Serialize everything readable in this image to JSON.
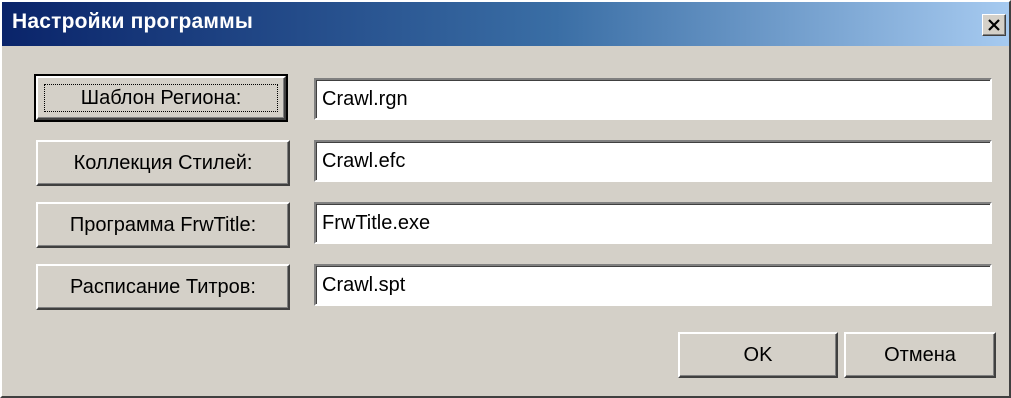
{
  "window": {
    "title": "Настройки программы",
    "close_symbol": "×"
  },
  "rows": [
    {
      "button_label": "Шаблон Региона:",
      "value": "Crawl.rgn"
    },
    {
      "button_label": "Коллекция Стилей:",
      "value": "Crawl.efc"
    },
    {
      "button_label": "Программа FrwTitle:",
      "value": "FrwTitle.exe"
    },
    {
      "button_label": "Расписание Титров:",
      "value": "Crawl.spt"
    }
  ],
  "actions": {
    "ok_label": "OK",
    "cancel_label": "Отмена"
  },
  "colors": {
    "dialog_face": "#d4d0c8",
    "title_gradient_start": "#0a246a",
    "title_gradient_end": "#a6caf0"
  }
}
